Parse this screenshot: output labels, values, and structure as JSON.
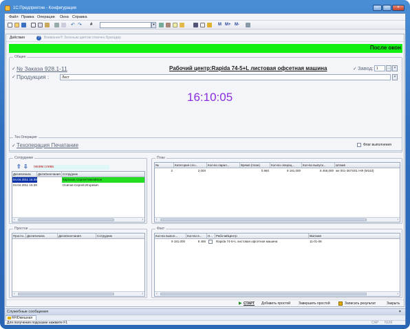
{
  "window": {
    "title": "1С:Предприятие - Конфигурация"
  },
  "menu": [
    "Файл",
    "Правка",
    "Операции",
    "Окна",
    "Справка"
  ],
  "toolbar": {
    "combo_value": "",
    "icons": [
      "new-icon",
      "open-icon",
      "save-icon",
      "cut-icon",
      "copy-icon",
      "paste-icon",
      "print-icon",
      "preview-icon",
      "undo-icon",
      "redo-icon",
      "find-icon"
    ]
  },
  "form": {
    "actions": {
      "label": "Действия",
      "help": "?",
      "disabled_items": "Внимание!!! Зеленым цветом отмечен  Бригадир"
    },
    "banner": "После окон",
    "general": {
      "legend": "Общее",
      "order": "№ Заказа 928.1-11",
      "workcenter": "Рабочий центр:Rapida 74-5+L листовая офсетная машина",
      "plant_label": "Завод:",
      "plant_value": "1",
      "product_label": "Продукция :",
      "product_value": "Лист",
      "clock": "16:10:05"
    },
    "tech": {
      "legend": "Тех.Операция",
      "operation": "Техоперация Печатание",
      "flag": "Флаг выполнения"
    },
    "staff": {
      "legend": "Сотрудники",
      "hint": "окоим слева",
      "headers": [
        "ДатаНачала",
        "ДатаОкончания",
        "Сотрудник"
      ],
      "rows": [
        {
          "start": "04.04.2011 15:39:45",
          "end": "",
          "employee": "Киргизов Сергей Михайлов"
        },
        {
          "start": "04.04.2011 15:39:45",
          "end": "",
          "employee": "Осипов Сергей Игоревич"
        }
      ]
    },
    "plan": {
      "legend": "План",
      "headers": [
        "№",
        "Категория сло...",
        "Кол-во парал...",
        "Время (план)",
        "Кол-во операц...",
        "Кол-во выпуск...",
        "Штамп"
      ],
      "rows": [
        {
          "n": "2",
          "cat": "2,000",
          "par": "",
          "time": "0,960",
          "ops": "9 181,000",
          "out": "8 456,000",
          "stamp": "же 001-3674/01 НФ (М163)"
        }
      ]
    },
    "downtime": {
      "legend": "Простои",
      "headers": [
        "Просто...",
        "ДатаНачала",
        "ДатаОкончания",
        "Сотрудник"
      ]
    },
    "fact": {
      "legend": "Факт",
      "headers": [
        "Кол-во выпол...",
        "Кол-во в...",
        "Н...",
        "РабочийЦентр",
        "ВШтамп"
      ],
      "rows": [
        {
          "done": "9 181,000",
          "qty": "8 456",
          "n": "",
          "wc": "Rapida 74-5+L листовая офсетная машина",
          "stamp": "11-01-08"
        }
      ]
    },
    "footer": {
      "start": "СТАРТ",
      "add_downtime": "Добавить простой",
      "end_downtime": "Завершить простой",
      "record": "Записать результат",
      "close": "Закрыть"
    }
  },
  "messages": {
    "title": "Служебные сообщения",
    "close": "×"
  },
  "taskbar": {
    "tab": "RFIDмешная"
  },
  "status": {
    "hint": "Для получения подсказки нажмите F1",
    "cap": "CAP",
    "num": "NUM"
  },
  "colors": {
    "banner": "#11ee11",
    "clock": "#8a2be2",
    "selected_row": "#0a32a8",
    "bright_cell": "#22dd22"
  }
}
